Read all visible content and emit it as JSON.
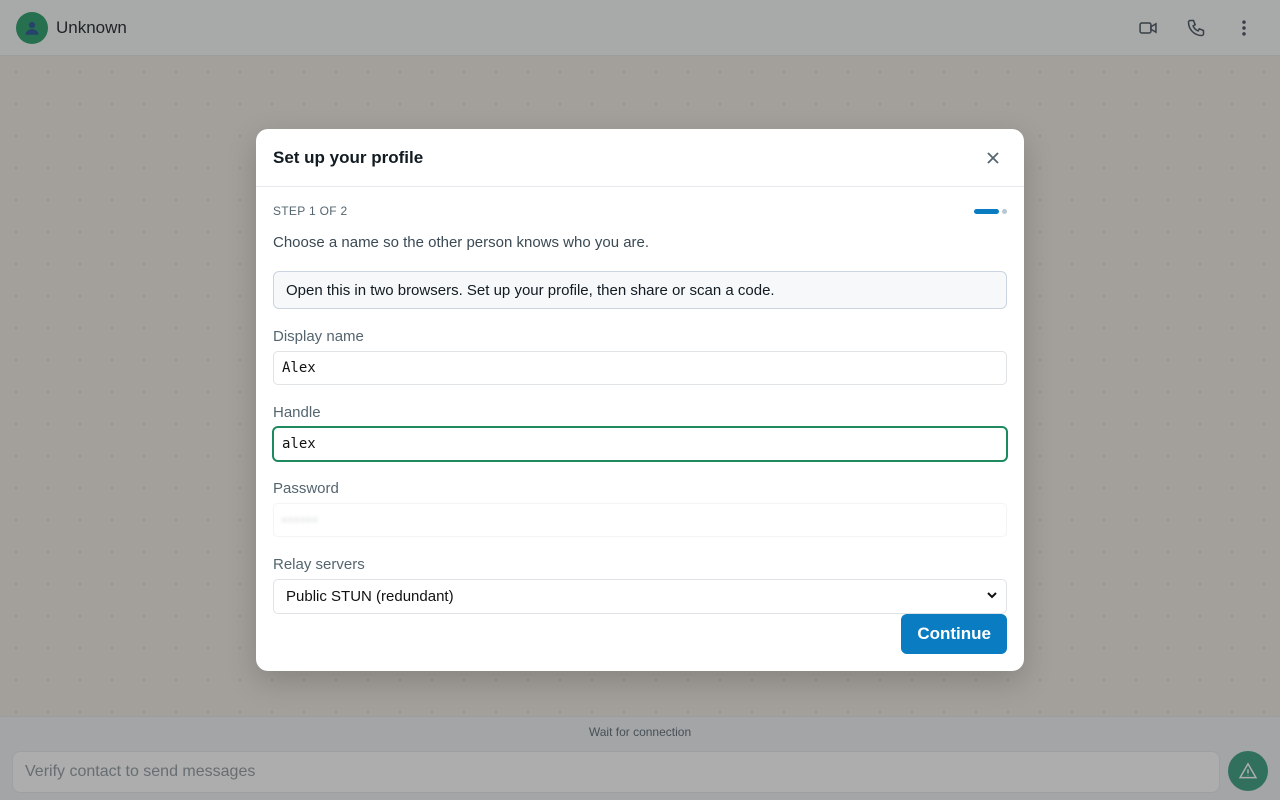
{
  "header": {
    "contact_name": "Unknown",
    "icons": [
      "video-icon",
      "phone-icon",
      "more-vertical-icon"
    ]
  },
  "footer": {
    "status": "Wait for connection",
    "compose_placeholder": "Verify contact to send messages",
    "action_icon": "warning-icon"
  },
  "modal": {
    "title": "Set up your profile",
    "step_label": "STEP 1 OF 2",
    "step_current": 1,
    "step_total": 2,
    "intro": "Choose a name so the other person knows who you are.",
    "info": "Open this in two browsers. Set up your profile, then share or scan a code.",
    "fields": {
      "display_name": {
        "label": "Display name",
        "value": "Alex"
      },
      "handle": {
        "label": "Handle",
        "value": "alex"
      },
      "password": {
        "label": "Password",
        "value": "••••••"
      },
      "relay": {
        "label": "Relay servers",
        "value": "Public STUN (redundant)"
      }
    },
    "continue_label": "Continue"
  },
  "colors": {
    "accent": "#0a7cc1",
    "focus": "#1f8a5f",
    "avatar": "#1f9a64"
  }
}
